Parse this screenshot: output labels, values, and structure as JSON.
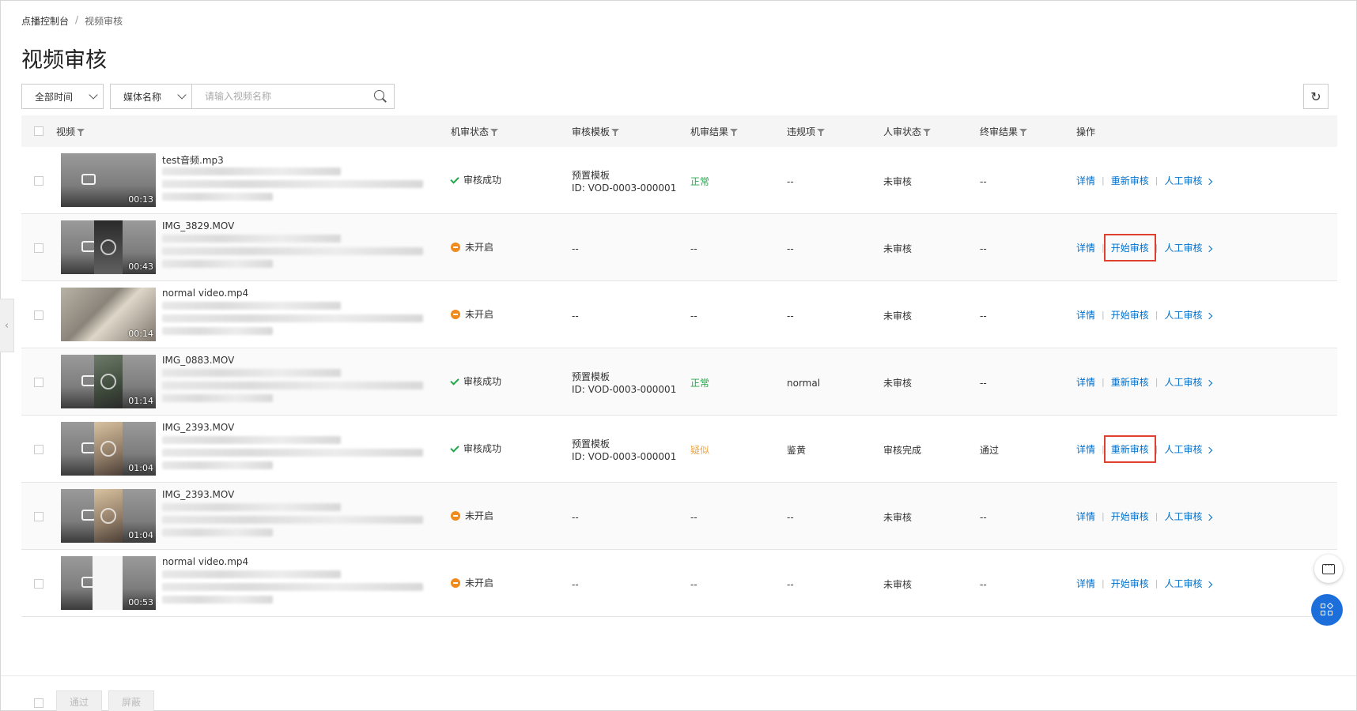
{
  "breadcrumb": {
    "root": "点播控制台",
    "separator": "/",
    "current": "视频审核"
  },
  "page_title": "视频审核",
  "toolbar": {
    "time_filter": "全部时间",
    "field_filter": "媒体名称",
    "search_placeholder": "请输入视频名称",
    "refresh_icon": "refresh-icon"
  },
  "table": {
    "columns": {
      "video": "视频",
      "machine_status": "机审状态",
      "template": "审核模板",
      "machine_result": "机审结果",
      "violation": "违规项",
      "human_status": "人审状态",
      "final_result": "终审结果",
      "actions": "操作"
    },
    "rows": [
      {
        "name": "test音频.mp3",
        "duration": "00:13",
        "machine_status": "审核成功",
        "status_type": "success",
        "template_name": "预置模板",
        "template_id": "ID: VOD-0003-000001",
        "machine_result": "正常",
        "result_type": "normal",
        "violation": "--",
        "human_status": "未审核",
        "final_result": "--",
        "action_detail": "详情",
        "action_review": "重新审核",
        "action_human": "人工审核",
        "highlighted": false
      },
      {
        "name": "IMG_3829.MOV",
        "duration": "00:43",
        "machine_status": "未开启",
        "status_type": "off",
        "template_name": "--",
        "template_id": "",
        "machine_result": "--",
        "result_type": "none",
        "violation": "--",
        "human_status": "未审核",
        "final_result": "--",
        "action_detail": "详情",
        "action_review": "开始审核",
        "action_human": "人工审核",
        "highlighted": true
      },
      {
        "name": "normal video.mp4",
        "duration": "00:14",
        "machine_status": "未开启",
        "status_type": "off",
        "template_name": "--",
        "template_id": "",
        "machine_result": "--",
        "result_type": "none",
        "violation": "--",
        "human_status": "未审核",
        "final_result": "--",
        "action_detail": "详情",
        "action_review": "开始审核",
        "action_human": "人工审核",
        "highlighted": false
      },
      {
        "name": "IMG_0883.MOV",
        "duration": "01:14",
        "machine_status": "审核成功",
        "status_type": "success",
        "template_name": "预置模板",
        "template_id": "ID: VOD-0003-000001",
        "machine_result": "正常",
        "result_type": "normal",
        "violation": "normal",
        "human_status": "未审核",
        "final_result": "--",
        "action_detail": "详情",
        "action_review": "重新审核",
        "action_human": "人工审核",
        "highlighted": false
      },
      {
        "name": "IMG_2393.MOV",
        "duration": "01:04",
        "machine_status": "审核成功",
        "status_type": "success",
        "template_name": "预置模板",
        "template_id": "ID: VOD-0003-000001",
        "machine_result": "疑似",
        "result_type": "suspect",
        "violation": "鉴黄",
        "human_status": "审核完成",
        "final_result": "通过",
        "action_detail": "详情",
        "action_review": "重新审核",
        "action_human": "人工审核",
        "highlighted": true
      },
      {
        "name": "IMG_2393.MOV",
        "duration": "01:04",
        "machine_status": "未开启",
        "status_type": "off",
        "template_name": "--",
        "template_id": "",
        "machine_result": "--",
        "result_type": "none",
        "violation": "--",
        "human_status": "未审核",
        "final_result": "--",
        "action_detail": "详情",
        "action_review": "开始审核",
        "action_human": "人工审核",
        "highlighted": false
      },
      {
        "name": "normal video.mp4",
        "duration": "00:53",
        "machine_status": "未开启",
        "status_type": "off",
        "template_name": "--",
        "template_id": "",
        "machine_result": "--",
        "result_type": "none",
        "violation": "--",
        "human_status": "未审核",
        "final_result": "--",
        "action_detail": "详情",
        "action_review": "开始审核",
        "action_human": "人工审核",
        "highlighted": false
      }
    ]
  },
  "footer": {
    "approve_label": "通过",
    "block_label": "屏蔽"
  },
  "colors": {
    "link": "#0070cc",
    "success": "#23a64a",
    "warning": "#f08a1d",
    "suspect": "#f0a640",
    "highlight_box": "#e0412f",
    "fab": "#1c6fdb"
  }
}
